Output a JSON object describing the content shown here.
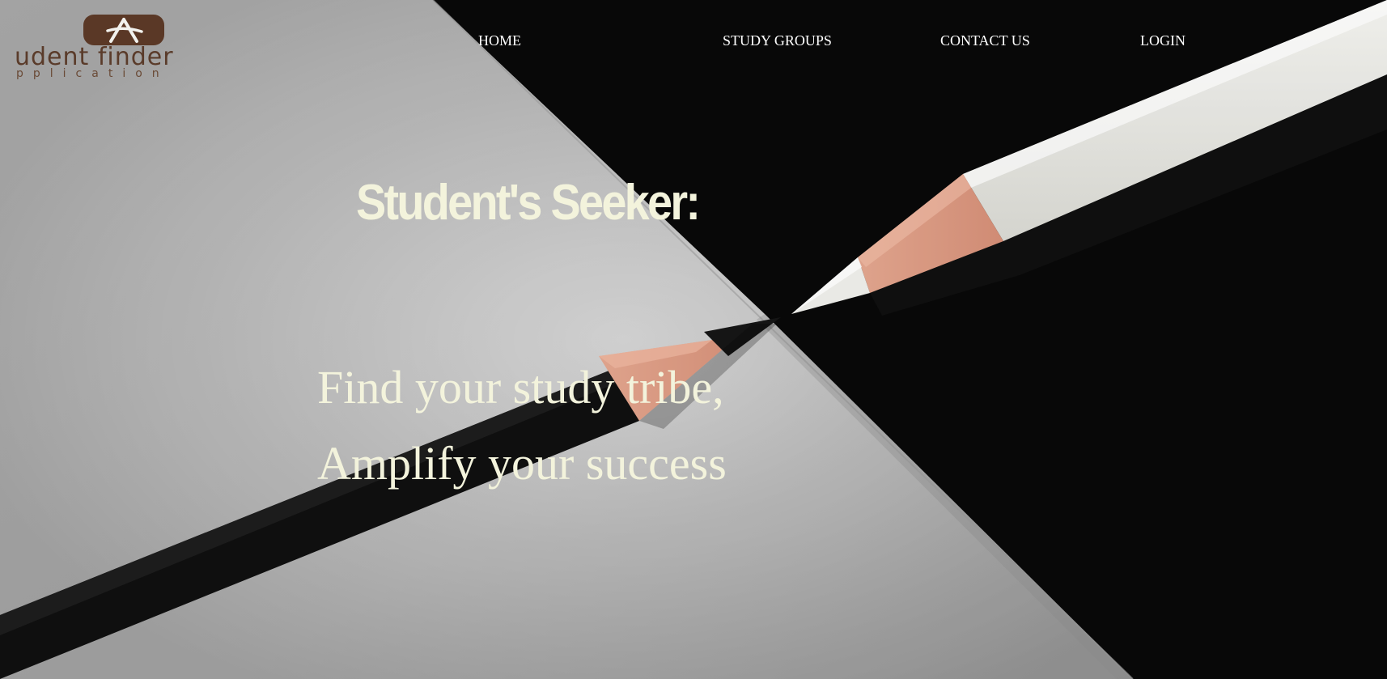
{
  "brand": {
    "logo_text": "udent finder",
    "logo_subtext": "pplication",
    "badge_glyph": "A",
    "badge_color": "#5a3826",
    "text_color": "#5a3b2a"
  },
  "nav": {
    "items": [
      {
        "label": "HOME"
      },
      {
        "label": "STUDY GROUPS"
      },
      {
        "label": "CONTACT US"
      },
      {
        "label": "LOGIN"
      }
    ]
  },
  "hero": {
    "title": "Student's Seeker:",
    "tagline_line1": "Find your study tribe,",
    "tagline_line2": "Amplify your success",
    "text_color": "#f3f3dc",
    "background": "two-pencils-tip-to-tip-photo"
  }
}
